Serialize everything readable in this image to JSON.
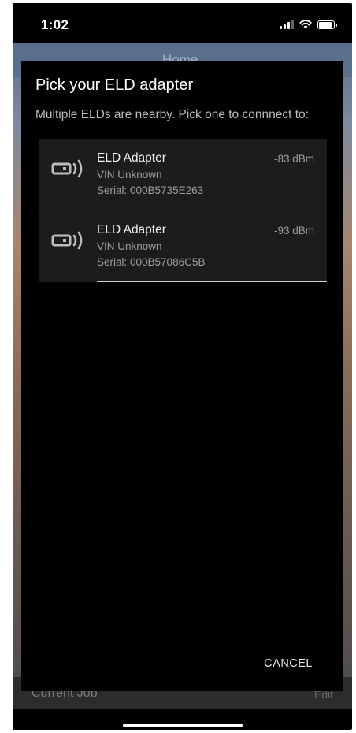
{
  "status_bar": {
    "time": "1:02",
    "icons": [
      "signal-icon",
      "wifi-icon",
      "battery-icon"
    ]
  },
  "background": {
    "title": "Home",
    "bottom_label": "Current Job",
    "bottom_right": "Edit"
  },
  "dialog": {
    "title": "Pick your ELD adapter",
    "subtitle": "Multiple ELDs are nearby. Pick one to connnect to:",
    "adapters": [
      {
        "name": "ELD Adapter",
        "vin": "VIN Unknown",
        "serial": "Serial: 000B5735E263",
        "signal": "-83 dBm",
        "icon": "eld-adapter-icon"
      },
      {
        "name": "ELD Adapter",
        "vin": "VIN Unknown",
        "serial": "Serial: 000B57086C5B",
        "signal": "-93 dBm",
        "icon": "eld-adapter-icon"
      }
    ],
    "cancel_label": "CANCEL"
  },
  "colors": {
    "dialog_background": "#000000",
    "list_background": "#1c1c1c",
    "primary_text": "#f2f2f2",
    "secondary_text": "#9e9e9e"
  }
}
